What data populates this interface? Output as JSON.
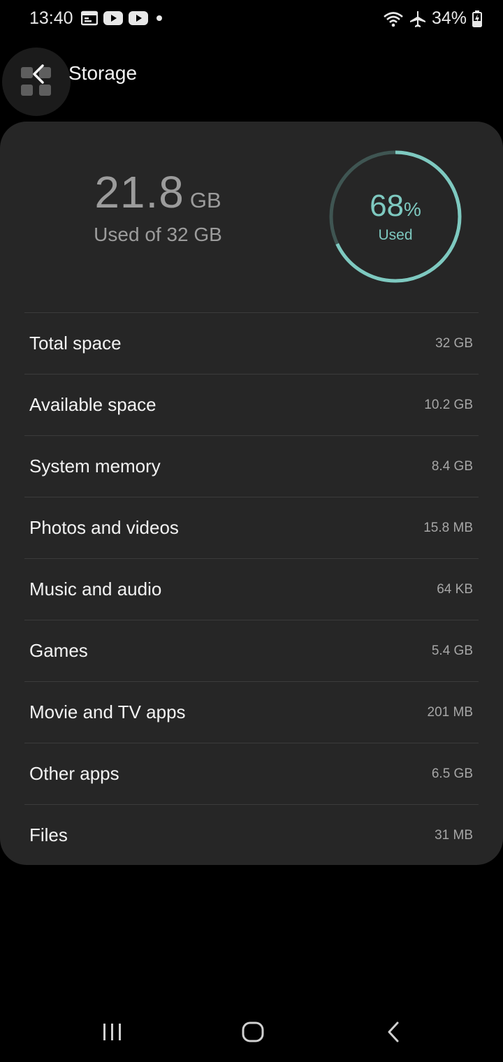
{
  "status_bar": {
    "time": "13:40",
    "battery": "34%"
  },
  "header": {
    "title": "Storage"
  },
  "summary": {
    "used_value": "21.8",
    "used_unit": "GB",
    "subtitle": "Used of 32 GB",
    "percent_number": "68",
    "percent_sign": "%",
    "percent_label": "Used",
    "percent_fraction": 0.68,
    "ring_color": "#7ec9c0",
    "ring_track_color": "#3f5552"
  },
  "storage_items": [
    {
      "label": "Total space",
      "value": "32 GB"
    },
    {
      "label": "Available space",
      "value": "10.2 GB"
    },
    {
      "label": "System memory",
      "value": "8.4 GB"
    },
    {
      "label": "Photos and videos",
      "value": "15.8 MB"
    },
    {
      "label": "Music and audio",
      "value": "64 KB"
    },
    {
      "label": "Games",
      "value": "5.4 GB"
    },
    {
      "label": "Movie and TV apps",
      "value": "201 MB"
    },
    {
      "label": "Other apps",
      "value": "6.5 GB"
    },
    {
      "label": "Files",
      "value": "31 MB"
    }
  ],
  "icons": {
    "status_left": [
      "calendar-icon",
      "youtube-icon",
      "youtube-icon",
      "notification-dot-icon"
    ],
    "status_right": [
      "wifi-icon",
      "airplane-icon",
      "battery-charging-icon"
    ],
    "nav": [
      "recent-apps-icon",
      "home-icon",
      "back-icon"
    ]
  }
}
